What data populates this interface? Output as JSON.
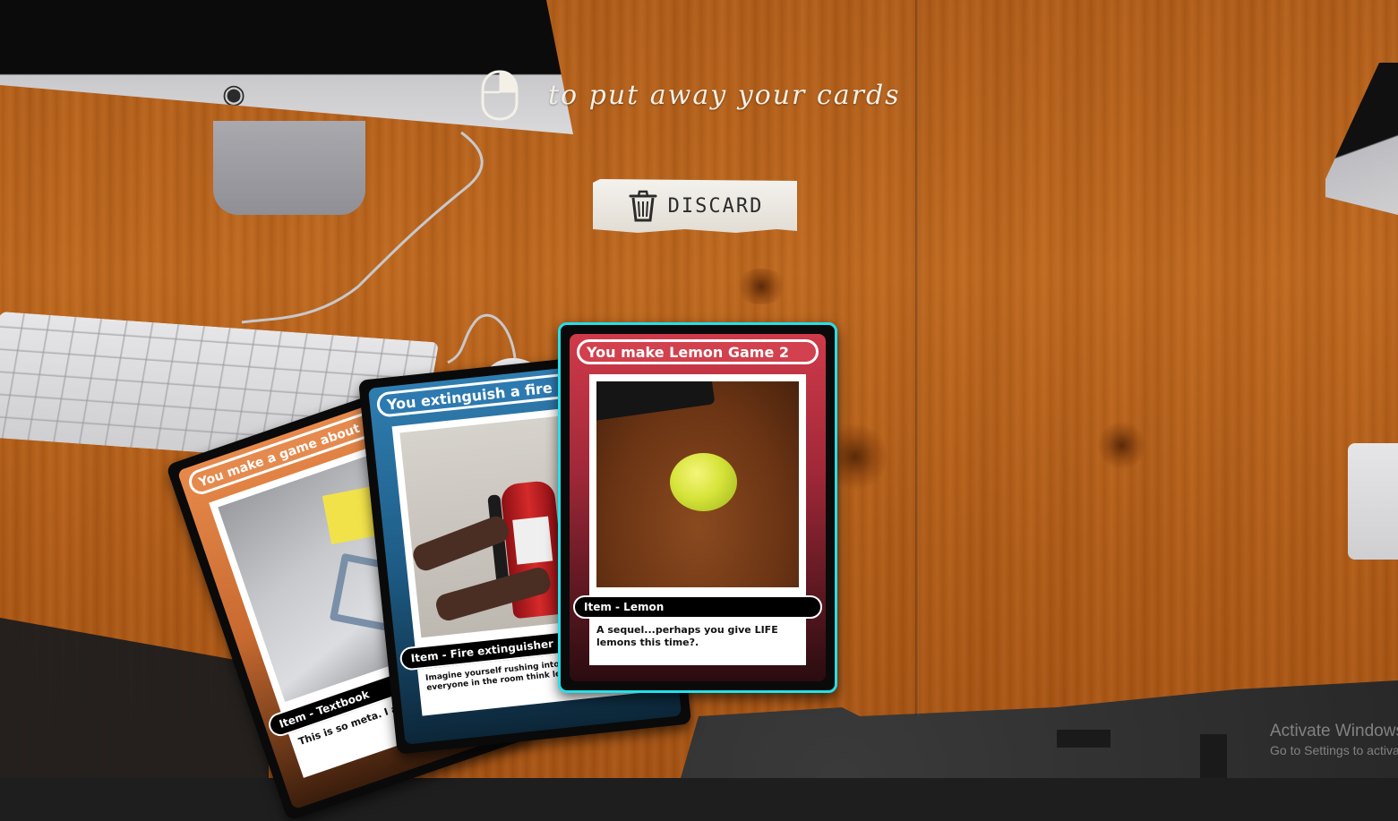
{
  "hint": {
    "icon": "right-mouse-button-icon",
    "text": "to put away your cards"
  },
  "discard": {
    "icon": "trash-can-icon",
    "label": "DISCARD"
  },
  "hand": {
    "cards": [
      {
        "title": "You make a game about game",
        "type": "Item - Textbook",
        "description": "This is so meta. I am co",
        "color": "#e58a4e",
        "photo": "textbook-with-sticky-note"
      },
      {
        "title": "You extinguish a fire",
        "type": "Item - Fire extinguisher",
        "description": "Imagine yourself rushing into act making everyone in the room think legend..",
        "color": "#2d7ab0",
        "photo": "red-fire-extinguisher"
      },
      {
        "title": "You make Lemon Game 2",
        "type": "Item - Lemon",
        "description": "A sequel...perhaps you give LIFE lemons this time?.",
        "color": "#d2414d",
        "photo": "lemon-on-desk",
        "selected": true,
        "highlight_color": "#22e0ea"
      }
    ]
  },
  "watermark": {
    "title": "Activate Windows",
    "subtitle": "Go to Settings to activate Windows."
  }
}
